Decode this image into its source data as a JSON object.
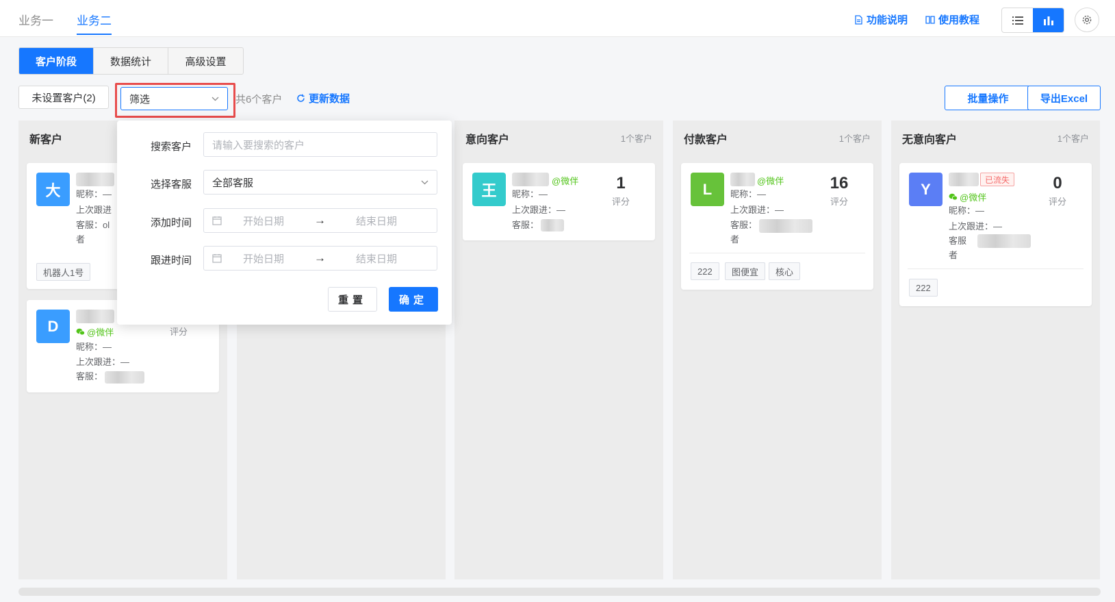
{
  "top_tabs": [
    {
      "label": "业务一",
      "active": false
    },
    {
      "label": "业务二",
      "active": true
    }
  ],
  "header_links": {
    "feature_doc": "功能说明",
    "tutorial": "使用教程"
  },
  "view_modes": [
    "list",
    "chart"
  ],
  "active_view": "chart",
  "seg_tabs": [
    {
      "label": "客户阶段",
      "active": true
    },
    {
      "label": "数据统计",
      "active": false
    },
    {
      "label": "高级设置",
      "active": false
    }
  ],
  "toolbar": {
    "unset_customers": "未设置客户(2)",
    "filter_label": "筛选",
    "total": "共6个客户",
    "refresh": "更新数据",
    "batch": "批量操作",
    "export": "导出Excel"
  },
  "filter_popup": {
    "search_label": "搜索客户",
    "search_placeholder": "请输入要搜索的客户",
    "agent_label": "选择客服",
    "agent_value": "全部客服",
    "add_time_label": "添加时间",
    "follow_time_label": "跟进时间",
    "start_placeholder": "开始日期",
    "end_placeholder": "结束日期",
    "arrow": "→",
    "reset": "重置",
    "confirm": "确定"
  },
  "columns": [
    {
      "title": "新客户",
      "count": "",
      "cards": [
        {
          "initial": "大",
          "color": "#3a9dff",
          "nickname": "昵称：—",
          "last_follow": "上次跟进",
          "agent": "客服：ol",
          "agent_suffix": "者",
          "tags": [
            "机器人1号"
          ]
        },
        {
          "initial": "D",
          "color": "#3a9dff",
          "wechat": "@微伴",
          "nickname": "昵称：—",
          "last_follow": "上次跟进：—",
          "agent": "客服：",
          "score_label": "评分"
        }
      ]
    },
    {
      "title": "",
      "count": "",
      "cards": []
    },
    {
      "title": "意向客户",
      "count": "1个客户",
      "cards": [
        {
          "initial": "王",
          "color": "#33cbcc",
          "wechat": "@微伴",
          "nickname": "昵称：—",
          "last_follow": "上次跟进：—",
          "agent": "客服：",
          "score": "1",
          "score_label": "评分"
        }
      ]
    },
    {
      "title": "付款客户",
      "count": "1个客户",
      "cards": [
        {
          "initial": "L",
          "color": "#67c23a",
          "wechat": "@微伴",
          "nickname": "昵称：—",
          "last_follow": "上次跟进：—",
          "agent": "客服：",
          "agent_suffix": "者",
          "score": "16",
          "score_label": "评分",
          "tags": [
            "222",
            "图便宜",
            "核心"
          ]
        }
      ]
    },
    {
      "title": "无意向客户",
      "count": "1个客户",
      "cards": [
        {
          "initial": "Y",
          "color": "#5b7ef5",
          "badge": "已流失",
          "wechat": "@微伴",
          "nickname": "昵称：—",
          "last_follow": "上次跟进：—",
          "agent": "客服",
          "agent_suffix": "者",
          "score": "0",
          "score_label": "评分",
          "tags": [
            "222"
          ]
        }
      ]
    }
  ],
  "colors": {
    "primary": "#1677ff",
    "highlight": "#e84c4c",
    "wechat": "#52c41a"
  }
}
